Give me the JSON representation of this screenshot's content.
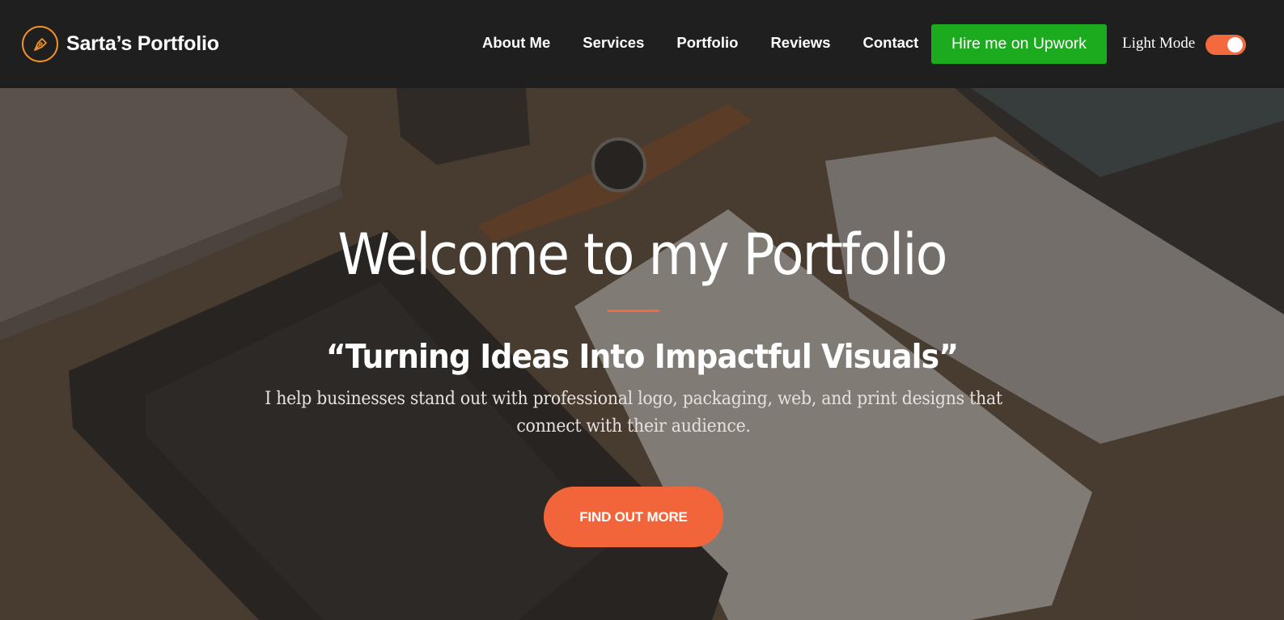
{
  "brand": {
    "name": "Sarta’s Portfolio",
    "logo_icon": "pen-nib-icon"
  },
  "nav": {
    "links": [
      "About Me",
      "Services",
      "Portfolio",
      "Reviews",
      "Contact"
    ],
    "hire_button": "Hire me on Upwork",
    "mode_label": "Light Mode",
    "mode_toggle_on": true
  },
  "hero": {
    "title": "Welcome to my Portfolio",
    "tagline": "“Turning Ideas Into Impactful Visuals”",
    "description": "I help businesses stand out with professional logo, packaging, web, and print designs that connect with their audience.",
    "cta_label": "FIND OUT MORE"
  },
  "colors": {
    "navbar_bg": "#1f1f1f",
    "accent": "#f26a3e",
    "upwork_green": "#1caa1e",
    "logo_orange": "#f0912a"
  }
}
